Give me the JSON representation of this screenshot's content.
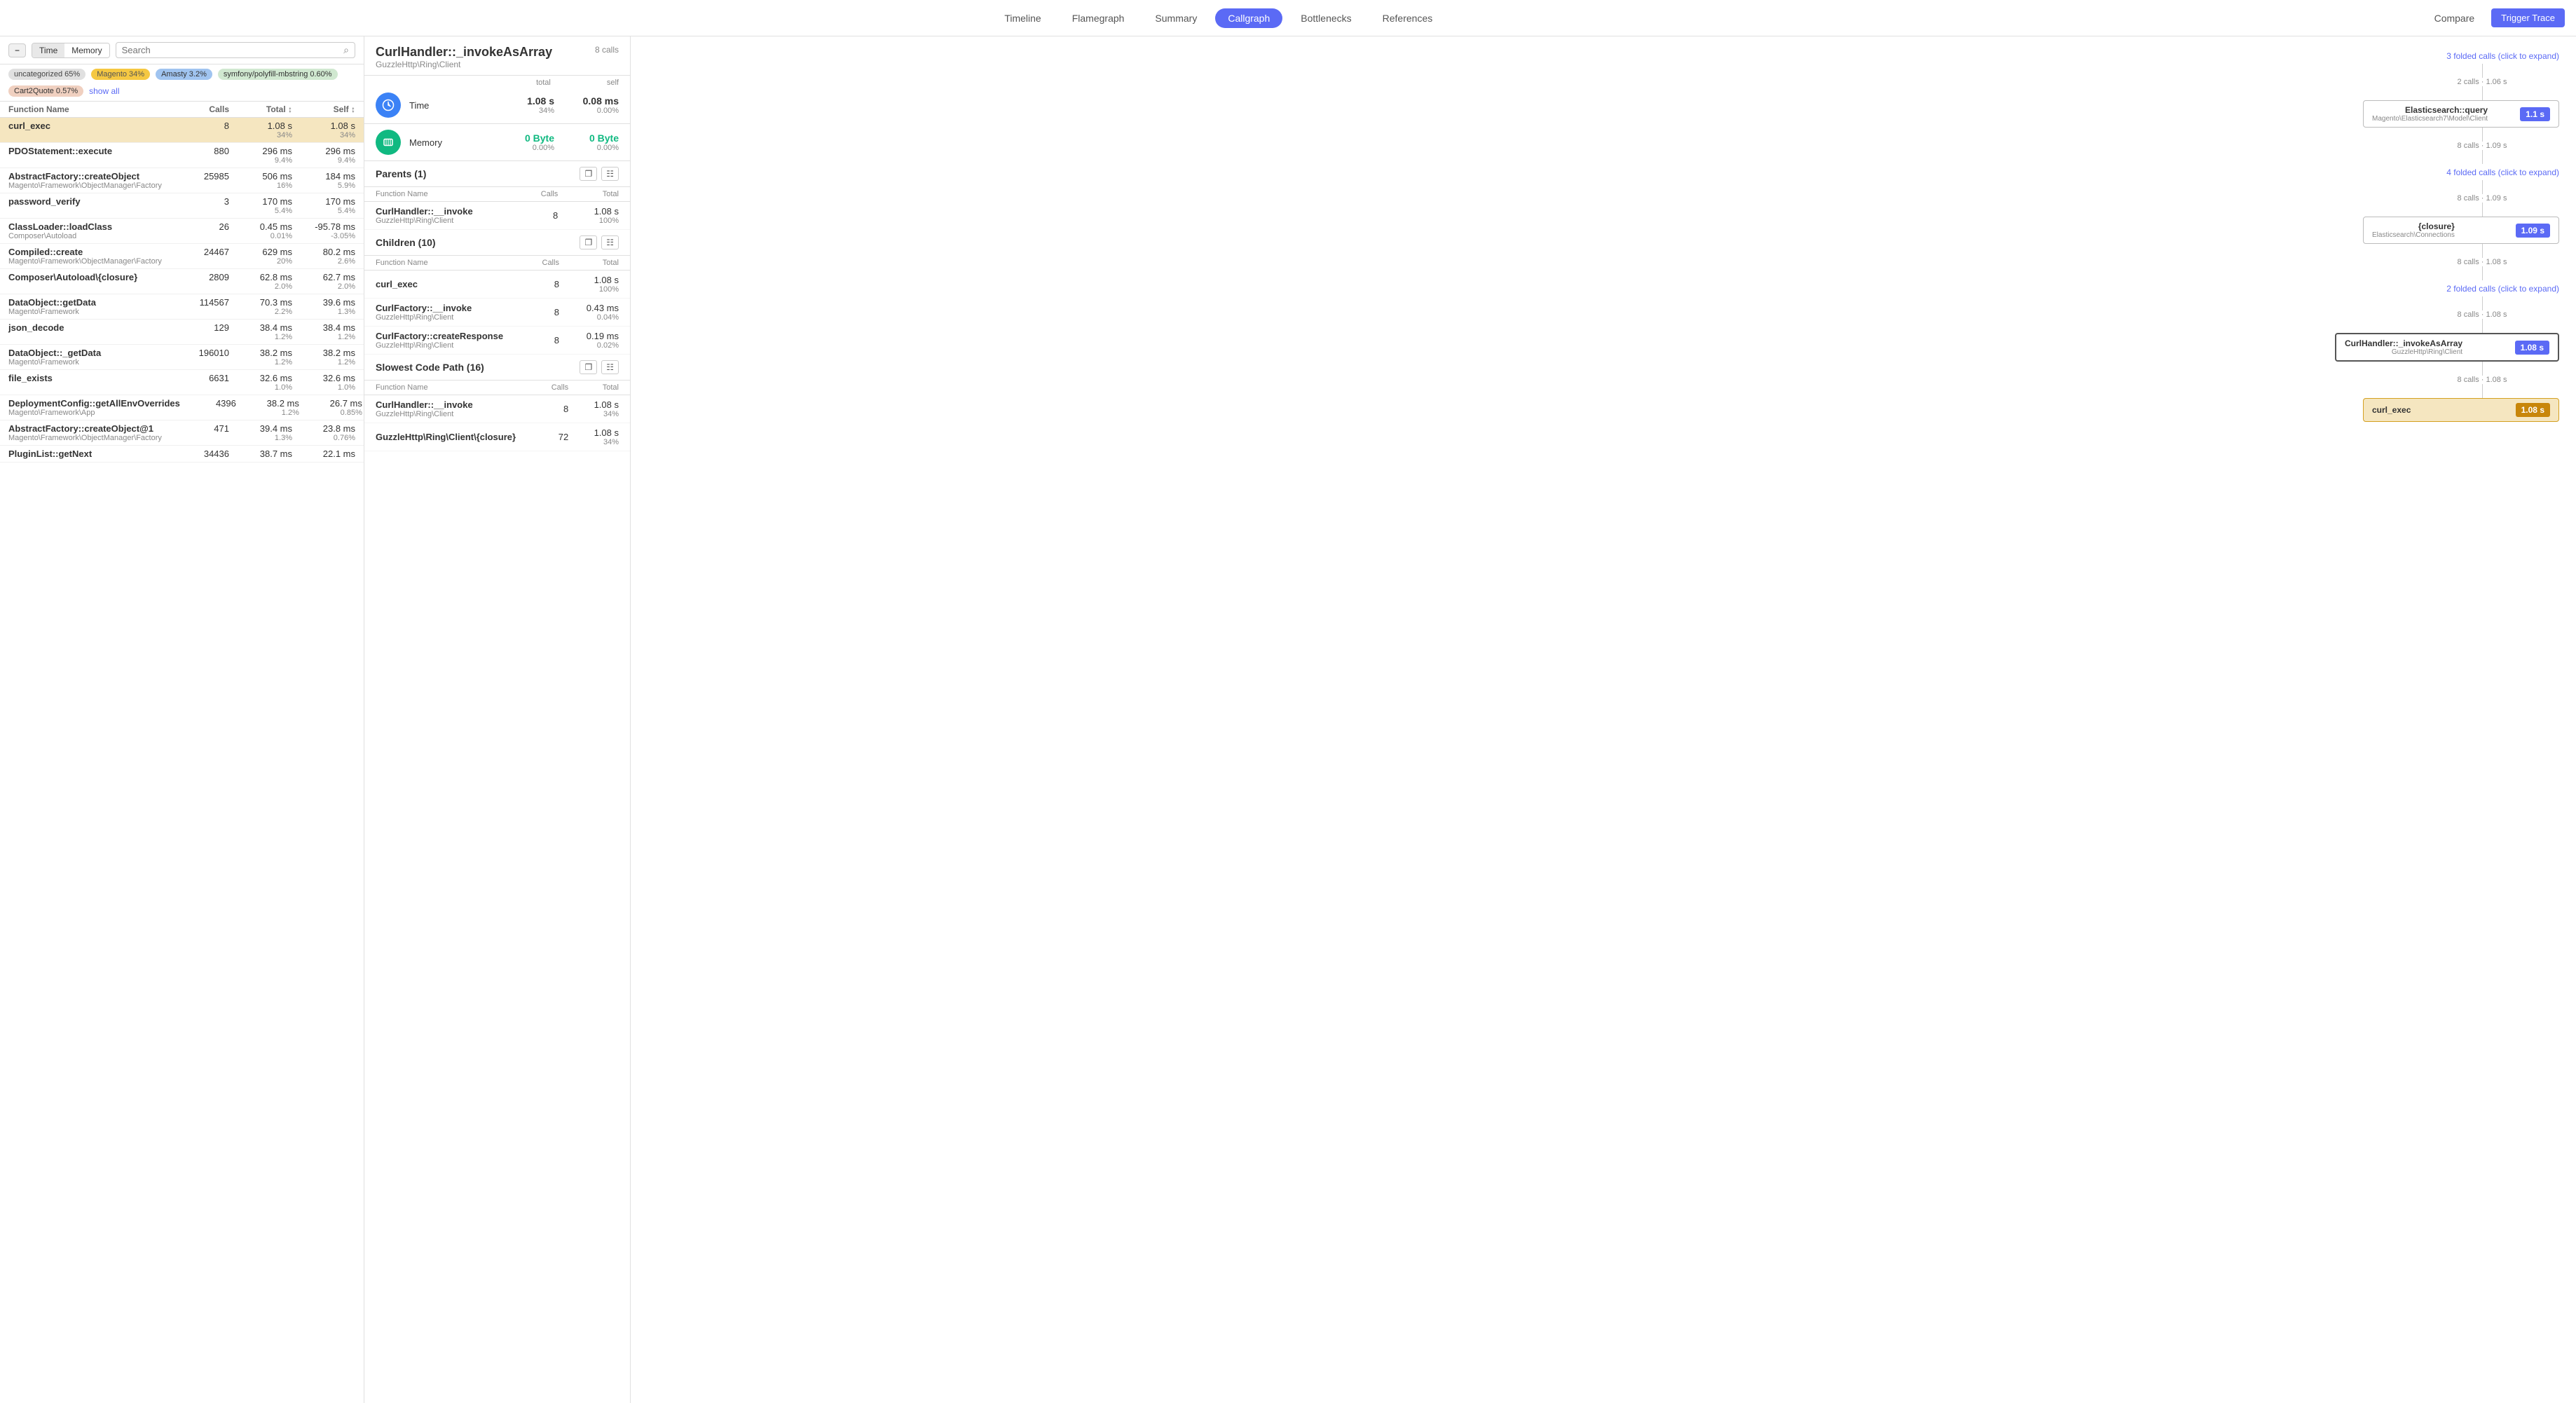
{
  "nav": {
    "tabs": [
      {
        "label": "Timeline",
        "active": false
      },
      {
        "label": "Flamegraph",
        "active": false
      },
      {
        "label": "Summary",
        "active": false
      },
      {
        "label": "Callgraph",
        "active": true
      },
      {
        "label": "Bottlenecks",
        "active": false
      },
      {
        "label": "References",
        "active": false
      }
    ],
    "compare_label": "Compare",
    "trigger_trace_label": "Trigger Trace"
  },
  "left_panel": {
    "toggle_label": "−",
    "time_tab": "Time",
    "memory_tab": "Memory",
    "search_placeholder": "Search",
    "filters": [
      {
        "label": "uncategorized 65%",
        "class": "tag-uncategorized"
      },
      {
        "label": "Magento 34%",
        "class": "tag-magento"
      },
      {
        "label": "Amasty 3.2%",
        "class": "tag-amasty"
      },
      {
        "label": "symfony/polyfill-mbstring 0.60%",
        "class": "tag-symfony"
      },
      {
        "label": "Cart2Quote 0.57%",
        "class": "tag-cart2quote"
      }
    ],
    "show_all_label": "show all",
    "table_headers": [
      "Function Name",
      "Calls",
      "Total",
      "Self"
    ],
    "rows": [
      {
        "name": "curl_exec",
        "namespace": "",
        "calls": "8",
        "total": "1.08 s",
        "total_pct": "34%",
        "self": "1.08 s",
        "self_pct": "34%",
        "highlighted": true
      },
      {
        "name": "PDOStatement::execute",
        "namespace": "",
        "calls": "880",
        "total": "296 ms",
        "total_pct": "9.4%",
        "self": "296 ms",
        "self_pct": "9.4%",
        "highlighted": false
      },
      {
        "name": "AbstractFactory::createObject",
        "namespace": "Magento\\Framework\\ObjectManager\\Factory",
        "calls": "25985",
        "total": "506 ms",
        "total_pct": "16%",
        "self": "184 ms",
        "self_pct": "5.9%",
        "highlighted": false
      },
      {
        "name": "password_verify",
        "namespace": "",
        "calls": "3",
        "total": "170 ms",
        "total_pct": "5.4%",
        "self": "170 ms",
        "self_pct": "5.4%",
        "highlighted": false
      },
      {
        "name": "ClassLoader::loadClass",
        "namespace": "Composer\\Autoload",
        "calls": "26",
        "total": "0.45 ms",
        "total_pct": "0.01%",
        "self": "-95.78 ms",
        "self_pct": "-3.05%",
        "highlighted": false
      },
      {
        "name": "Compiled::create",
        "namespace": "Magento\\Framework\\ObjectManager\\Factory",
        "calls": "24467",
        "total": "629 ms",
        "total_pct": "20%",
        "self": "80.2 ms",
        "self_pct": "2.6%",
        "highlighted": false
      },
      {
        "name": "Composer\\Autoload\\{closure}",
        "namespace": "",
        "calls": "2809",
        "total": "62.8 ms",
        "total_pct": "2.0%",
        "self": "62.7 ms",
        "self_pct": "2.0%",
        "highlighted": false
      },
      {
        "name": "DataObject::getData",
        "namespace": "Magento\\Framework",
        "calls": "114567",
        "total": "70.3 ms",
        "total_pct": "2.2%",
        "self": "39.6 ms",
        "self_pct": "1.3%",
        "highlighted": false
      },
      {
        "name": "json_decode",
        "namespace": "",
        "calls": "129",
        "total": "38.4 ms",
        "total_pct": "1.2%",
        "self": "38.4 ms",
        "self_pct": "1.2%",
        "highlighted": false
      },
      {
        "name": "DataObject::_getData",
        "namespace": "Magento\\Framework",
        "calls": "196010",
        "total": "38.2 ms",
        "total_pct": "1.2%",
        "self": "38.2 ms",
        "self_pct": "1.2%",
        "highlighted": false
      },
      {
        "name": "file_exists",
        "namespace": "",
        "calls": "6631",
        "total": "32.6 ms",
        "total_pct": "1.0%",
        "self": "32.6 ms",
        "self_pct": "1.0%",
        "highlighted": false
      },
      {
        "name": "DeploymentConfig::getAllEnvOverrides",
        "namespace": "Magento\\Framework\\App",
        "calls": "4396",
        "total": "38.2 ms",
        "total_pct": "1.2%",
        "self": "26.7 ms",
        "self_pct": "0.85%",
        "highlighted": false
      },
      {
        "name": "AbstractFactory::createObject@1",
        "namespace": "Magento\\Framework\\ObjectManager\\Factory",
        "calls": "471",
        "total": "39.4 ms",
        "total_pct": "1.3%",
        "self": "23.8 ms",
        "self_pct": "0.76%",
        "highlighted": false
      },
      {
        "name": "PluginList::getNext",
        "namespace": "",
        "calls": "34436",
        "total": "38.7 ms",
        "total_pct": "",
        "self": "22.1 ms",
        "self_pct": "",
        "highlighted": false
      }
    ]
  },
  "middle_panel": {
    "fn_name": "CurlHandler::_invokeAsArray",
    "namespace": "GuzzleHttp\\Ring\\Client",
    "calls_label": "8 calls",
    "total_label": "total",
    "self_label": "self",
    "time": {
      "label": "Time",
      "total_val": "1.08 s",
      "total_pct": "34%",
      "self_val": "0.08 ms",
      "self_pct": "0.00%"
    },
    "memory": {
      "label": "Memory",
      "total_val": "0 Byte",
      "total_pct": "0.00%",
      "self_val": "0 Byte",
      "self_pct": "0.00%"
    },
    "parents_section": {
      "title": "Parents (1)",
      "headers": [
        "Function Name",
        "Calls",
        "Total"
      ],
      "rows": [
        {
          "name": "CurlHandler::__invoke",
          "namespace": "GuzzleHttp\\Ring\\Client",
          "calls": "8",
          "total": "1.08 s",
          "total_pct": "100%"
        }
      ]
    },
    "children_section": {
      "title": "Children (10)",
      "headers": [
        "Function Name",
        "Calls",
        "Total"
      ],
      "rows": [
        {
          "name": "curl_exec",
          "namespace": "",
          "calls": "8",
          "total": "1.08 s",
          "total_pct": "100%"
        },
        {
          "name": "CurlFactory::__invoke",
          "namespace": "GuzzleHttp\\Ring\\Client",
          "calls": "8",
          "total": "0.43 ms",
          "total_pct": "0.04%"
        },
        {
          "name": "CurlFactory::createResponse",
          "namespace": "GuzzleHttp\\Ring\\Client",
          "calls": "8",
          "total": "0.19 ms",
          "total_pct": "0.02%"
        }
      ]
    },
    "slowest_section": {
      "title": "Slowest Code Path (16)",
      "headers": [
        "Function Name",
        "Calls",
        "Total"
      ],
      "rows": [
        {
          "name": "CurlHandler::__invoke",
          "namespace": "GuzzleHttp\\Ring\\Client",
          "calls": "8",
          "total": "1.08 s",
          "total_pct": "34%"
        },
        {
          "name": "GuzzleHttp\\Ring\\Client\\{closure}",
          "namespace": "",
          "calls": "72",
          "total": "1.08 s",
          "total_pct": "34%"
        }
      ]
    }
  },
  "right_panel": {
    "nodes": [
      {
        "type": "fold",
        "label": "3 folded calls (click to expand)"
      },
      {
        "type": "connector",
        "label": "2 calls · 1.06 s"
      },
      {
        "type": "node",
        "name": "Elasticsearch::query",
        "namespace": "Magento\\Elasticsearch7\\Model\\Client",
        "badge": "1.1 s",
        "badge_class": ""
      },
      {
        "type": "connector",
        "label": "8 calls · 1.09 s"
      },
      {
        "type": "fold",
        "label": "4 folded calls (click to expand)"
      },
      {
        "type": "connector",
        "label": "8 calls · 1.09 s"
      },
      {
        "type": "node",
        "name": "{closure}",
        "namespace": "Elasticsearch\\Connections",
        "badge": "1.09 s",
        "badge_class": ""
      },
      {
        "type": "connector",
        "label": "8 calls · 1.08 s"
      },
      {
        "type": "fold",
        "label": "2 folded calls (click to expand)"
      },
      {
        "type": "connector",
        "label": "8 calls · 1.08 s"
      },
      {
        "type": "node",
        "name": "CurlHandler::_invokeAsArray",
        "namespace": "GuzzleHttp\\Ring\\Client",
        "badge": "1.08 s",
        "badge_class": "",
        "highlighted": true
      },
      {
        "type": "connector",
        "label": "8 calls · 1.08 s"
      },
      {
        "type": "node",
        "name": "curl_exec",
        "namespace": "",
        "badge": "1.08 s",
        "badge_class": "gold",
        "highlighted": true
      }
    ]
  }
}
